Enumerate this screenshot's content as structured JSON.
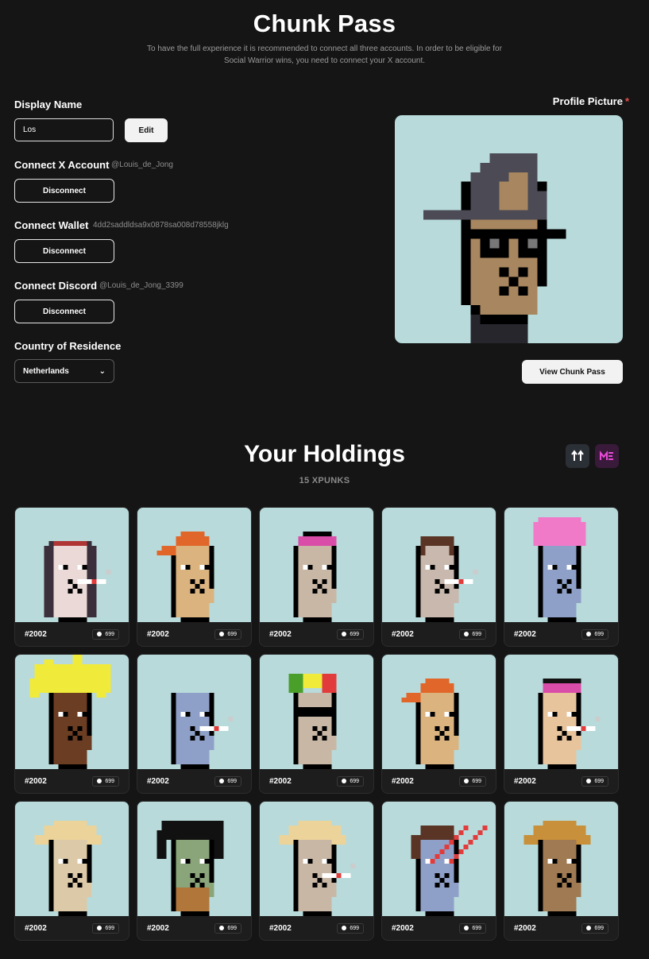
{
  "header": {
    "title": "Chunk Pass",
    "subtitle": "To have the full experience it is recommended to connect all three accounts. In order to be eligible for Social Warrior wins, you need to connect your X account."
  },
  "profile": {
    "display_name_label": "Display Name",
    "display_name_value": "Los",
    "edit_label": "Edit",
    "x_label": "Connect X Account",
    "x_handle": "@Louis_de_Jong",
    "wallet_label": "Connect Wallet",
    "wallet_address": "4dd2saddldsa9x0878sa008d78558jklg",
    "discord_label": "Connect Discord",
    "discord_handle": "@Louis_de_Jong_3399",
    "disconnect_label": "Disconnect",
    "country_label": "Country of Residence",
    "country_value": "Netherlands",
    "pfp_label": "Profile Picture",
    "pfp_required": "*",
    "view_label": "View Chunk Pass"
  },
  "holdings": {
    "title": "Your Holdings",
    "count": "15 XPUNKS",
    "marketplaces": [
      "tensor-icon",
      "magic-eden-icon"
    ],
    "items": [
      {
        "id": "#2002",
        "price": "699",
        "skin": "#ead9d6",
        "hair": "#3a2f3a",
        "acc": "#b03636",
        "style": "long"
      },
      {
        "id": "#2002",
        "price": "699",
        "skin": "#dbb37f",
        "hair": "#e0662a",
        "acc": "#e0662a",
        "style": "cap"
      },
      {
        "id": "#2002",
        "price": "699",
        "skin": "#c9b7a6",
        "hair": "#d94ca8",
        "acc": "#d94ca8",
        "style": "bandana"
      },
      {
        "id": "#2002",
        "price": "699",
        "skin": "#c8b8ad",
        "hair": "#5a3424",
        "acc": "#5a3424",
        "style": "short"
      },
      {
        "id": "#2002",
        "price": "699",
        "skin": "#8fa0c8",
        "hair": "#f07ac8",
        "acc": "#f07ac8",
        "style": "puff"
      },
      {
        "id": "#2002",
        "price": "699",
        "skin": "#6b3d22",
        "hair": "#f0ea3a",
        "acc": "#f0ea3a",
        "style": "spiky"
      },
      {
        "id": "#2002",
        "price": "699",
        "skin": "#8fa0c8",
        "hair": "#8fa0c8",
        "acc": "#8fa0c8",
        "style": "bald"
      },
      {
        "id": "#2002",
        "price": "699",
        "skin": "#c9b7a6",
        "hair": "#4a9e2a",
        "acc": "#e23b3b",
        "style": "rasta"
      },
      {
        "id": "#2002",
        "price": "699",
        "skin": "#dbb37f",
        "hair": "#e0662a",
        "acc": "#e0662a",
        "style": "cap"
      },
      {
        "id": "#2002",
        "price": "699",
        "skin": "#e8c49c",
        "hair": "#d94ca8",
        "acc": "#111111",
        "style": "bandana"
      },
      {
        "id": "#2002",
        "price": "699",
        "skin": "#dcc9a8",
        "hair": "#ecd39a",
        "acc": "#ecd39a",
        "style": "messy"
      },
      {
        "id": "#2002",
        "price": "699",
        "skin": "#8aa57a",
        "hair": "#111111",
        "acc": "#b0763a",
        "style": "wild"
      },
      {
        "id": "#2002",
        "price": "699",
        "skin": "#c9b7a6",
        "hair": "#ecd39a",
        "acc": "#ecd39a",
        "style": "messy"
      },
      {
        "id": "#2002",
        "price": "699",
        "skin": "#8fa0c8",
        "hair": "#5a3424",
        "acc": "#e23b3b",
        "style": "laser"
      },
      {
        "id": "#2002",
        "price": "699",
        "skin": "#a07a52",
        "hair": "#c8903a",
        "acc": "#111111",
        "style": "messy"
      }
    ]
  },
  "colors": {
    "background": "#151515",
    "card_bg": "#b8dada",
    "accent_red": "#e84c4c"
  }
}
